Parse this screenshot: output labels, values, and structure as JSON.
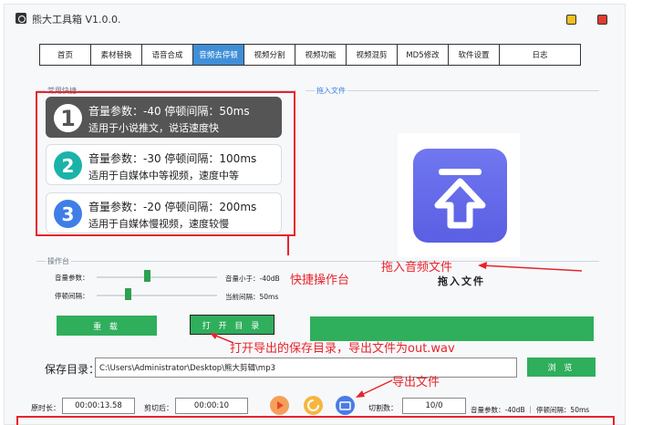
{
  "window": {
    "title": "熊大工具箱 V1.0.0."
  },
  "tabs": [
    "首页",
    "素材替换",
    "语音合成",
    "音频去停顿",
    "视频分割",
    "视频功能",
    "视频混剪",
    "MD5修改",
    "软件设置",
    "日志"
  ],
  "active_tab": 3,
  "groups": {
    "presets": "常用快捷",
    "drop": "拖入文件",
    "console": "操作台"
  },
  "presets": [
    {
      "num": "1",
      "line1": "音量参数：-40  停顿间隔：50ms",
      "line2": "适用于小说推文，说话速度快",
      "color": "#555555"
    },
    {
      "num": "2",
      "line1": "音量参数：-30  停顿间隔：100ms",
      "line2": "适用于自媒体中等视频，速度中等",
      "color": "#1bb3a8"
    },
    {
      "num": "3",
      "line1": "音量参数：-20  停顿间隔：200ms",
      "line2": "适用于自媒体慢视频，速度较慢",
      "color": "#3f7ee8"
    }
  ],
  "annotations": {
    "quick_console": "快捷操作台",
    "drag_audio": "拖入音频文件",
    "open_dir": "打开导出的保存目录，导出文件为out.wav",
    "export_file": "导出文件"
  },
  "drop_text": "拖入文件",
  "console": {
    "volume_label": "音量参数：",
    "volume_value": "音量小于：-40dB",
    "volume_level": 0.42,
    "pause_label": "停顿间隔：",
    "pause_value": "当前间隔：50ms",
    "pause_level": 0.26
  },
  "buttons": {
    "reload": "重 载",
    "open_dir": "打 开 目 录",
    "browse": "浏 览"
  },
  "save": {
    "label": "保存目录：",
    "path": "C:\\Users\\Administrator\\Desktop\\熊大剪辑\\mp3"
  },
  "bottom": {
    "orig_label": "原时长：",
    "orig_value": "00:00:13.58",
    "cut_label": "剪切后：",
    "cut_value": "00:00:10",
    "count_label": "切割数：",
    "count_value": "10/0",
    "status": "音量参数：-40dB ｜ 停顿间隔：50ms"
  },
  "colors": {
    "accent_tab": "#3f8fd8",
    "green": "#2fae5c",
    "annotation": "#e8242a",
    "upload_tile": "#5a5fe3"
  }
}
